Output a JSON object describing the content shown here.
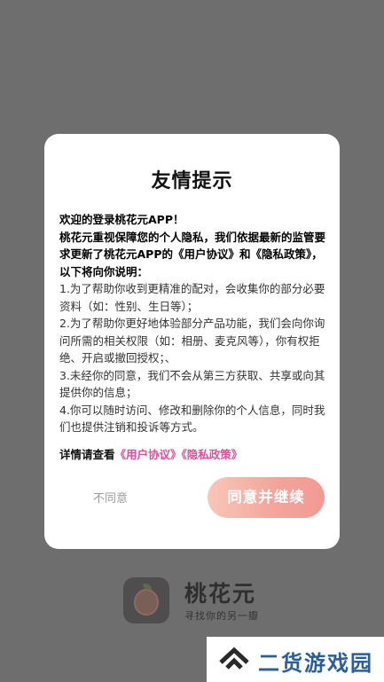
{
  "background": {
    "app_name": "桃花元",
    "app_slogan": "寻找你的另一瓣"
  },
  "dialog": {
    "title": "友情提示",
    "lines": [
      {
        "text": "欢迎的登录桃花元APP！",
        "bold": true
      },
      {
        "text": "桃花元重视保障您的个人隐私，我们依据最新的监管要求更新了桃花元APP的《用户协议》和《隐私政策》，以下将向你说明：",
        "bold": true
      },
      {
        "text": "1.为了帮助你收到更精准的配对，会收集你的部分必要资料（如：性别、生日等）；",
        "bold": false
      },
      {
        "text": "2.为了帮助你更好地体验部分产品功能，我们会向你询问所需的相关权限（如：相册、麦克风等），你有权拒绝、开启或撤回授权；、",
        "bold": false
      },
      {
        "text": "3.未经你的同意，我们不会从第三方获取、共享或向其提供你的信息；",
        "bold": false
      },
      {
        "text": "4.你可以随时访问、修改和删除你的个人信息，同时我们也提供注销和投诉等方式。",
        "bold": false
      }
    ],
    "details_prefix": "详情请查看",
    "link_user_agreement": "《用户协议》",
    "link_privacy_policy": "《隐私政策》",
    "disagree_label": "不同意",
    "agree_label": "同意并继续"
  },
  "watermark": {
    "text": "二货游戏园"
  },
  "colors": {
    "link": "#e24d9a",
    "agree_gradient_start": "#f9c6b8",
    "agree_gradient_end": "#f29a93",
    "watermark": "#2b5e9c"
  }
}
